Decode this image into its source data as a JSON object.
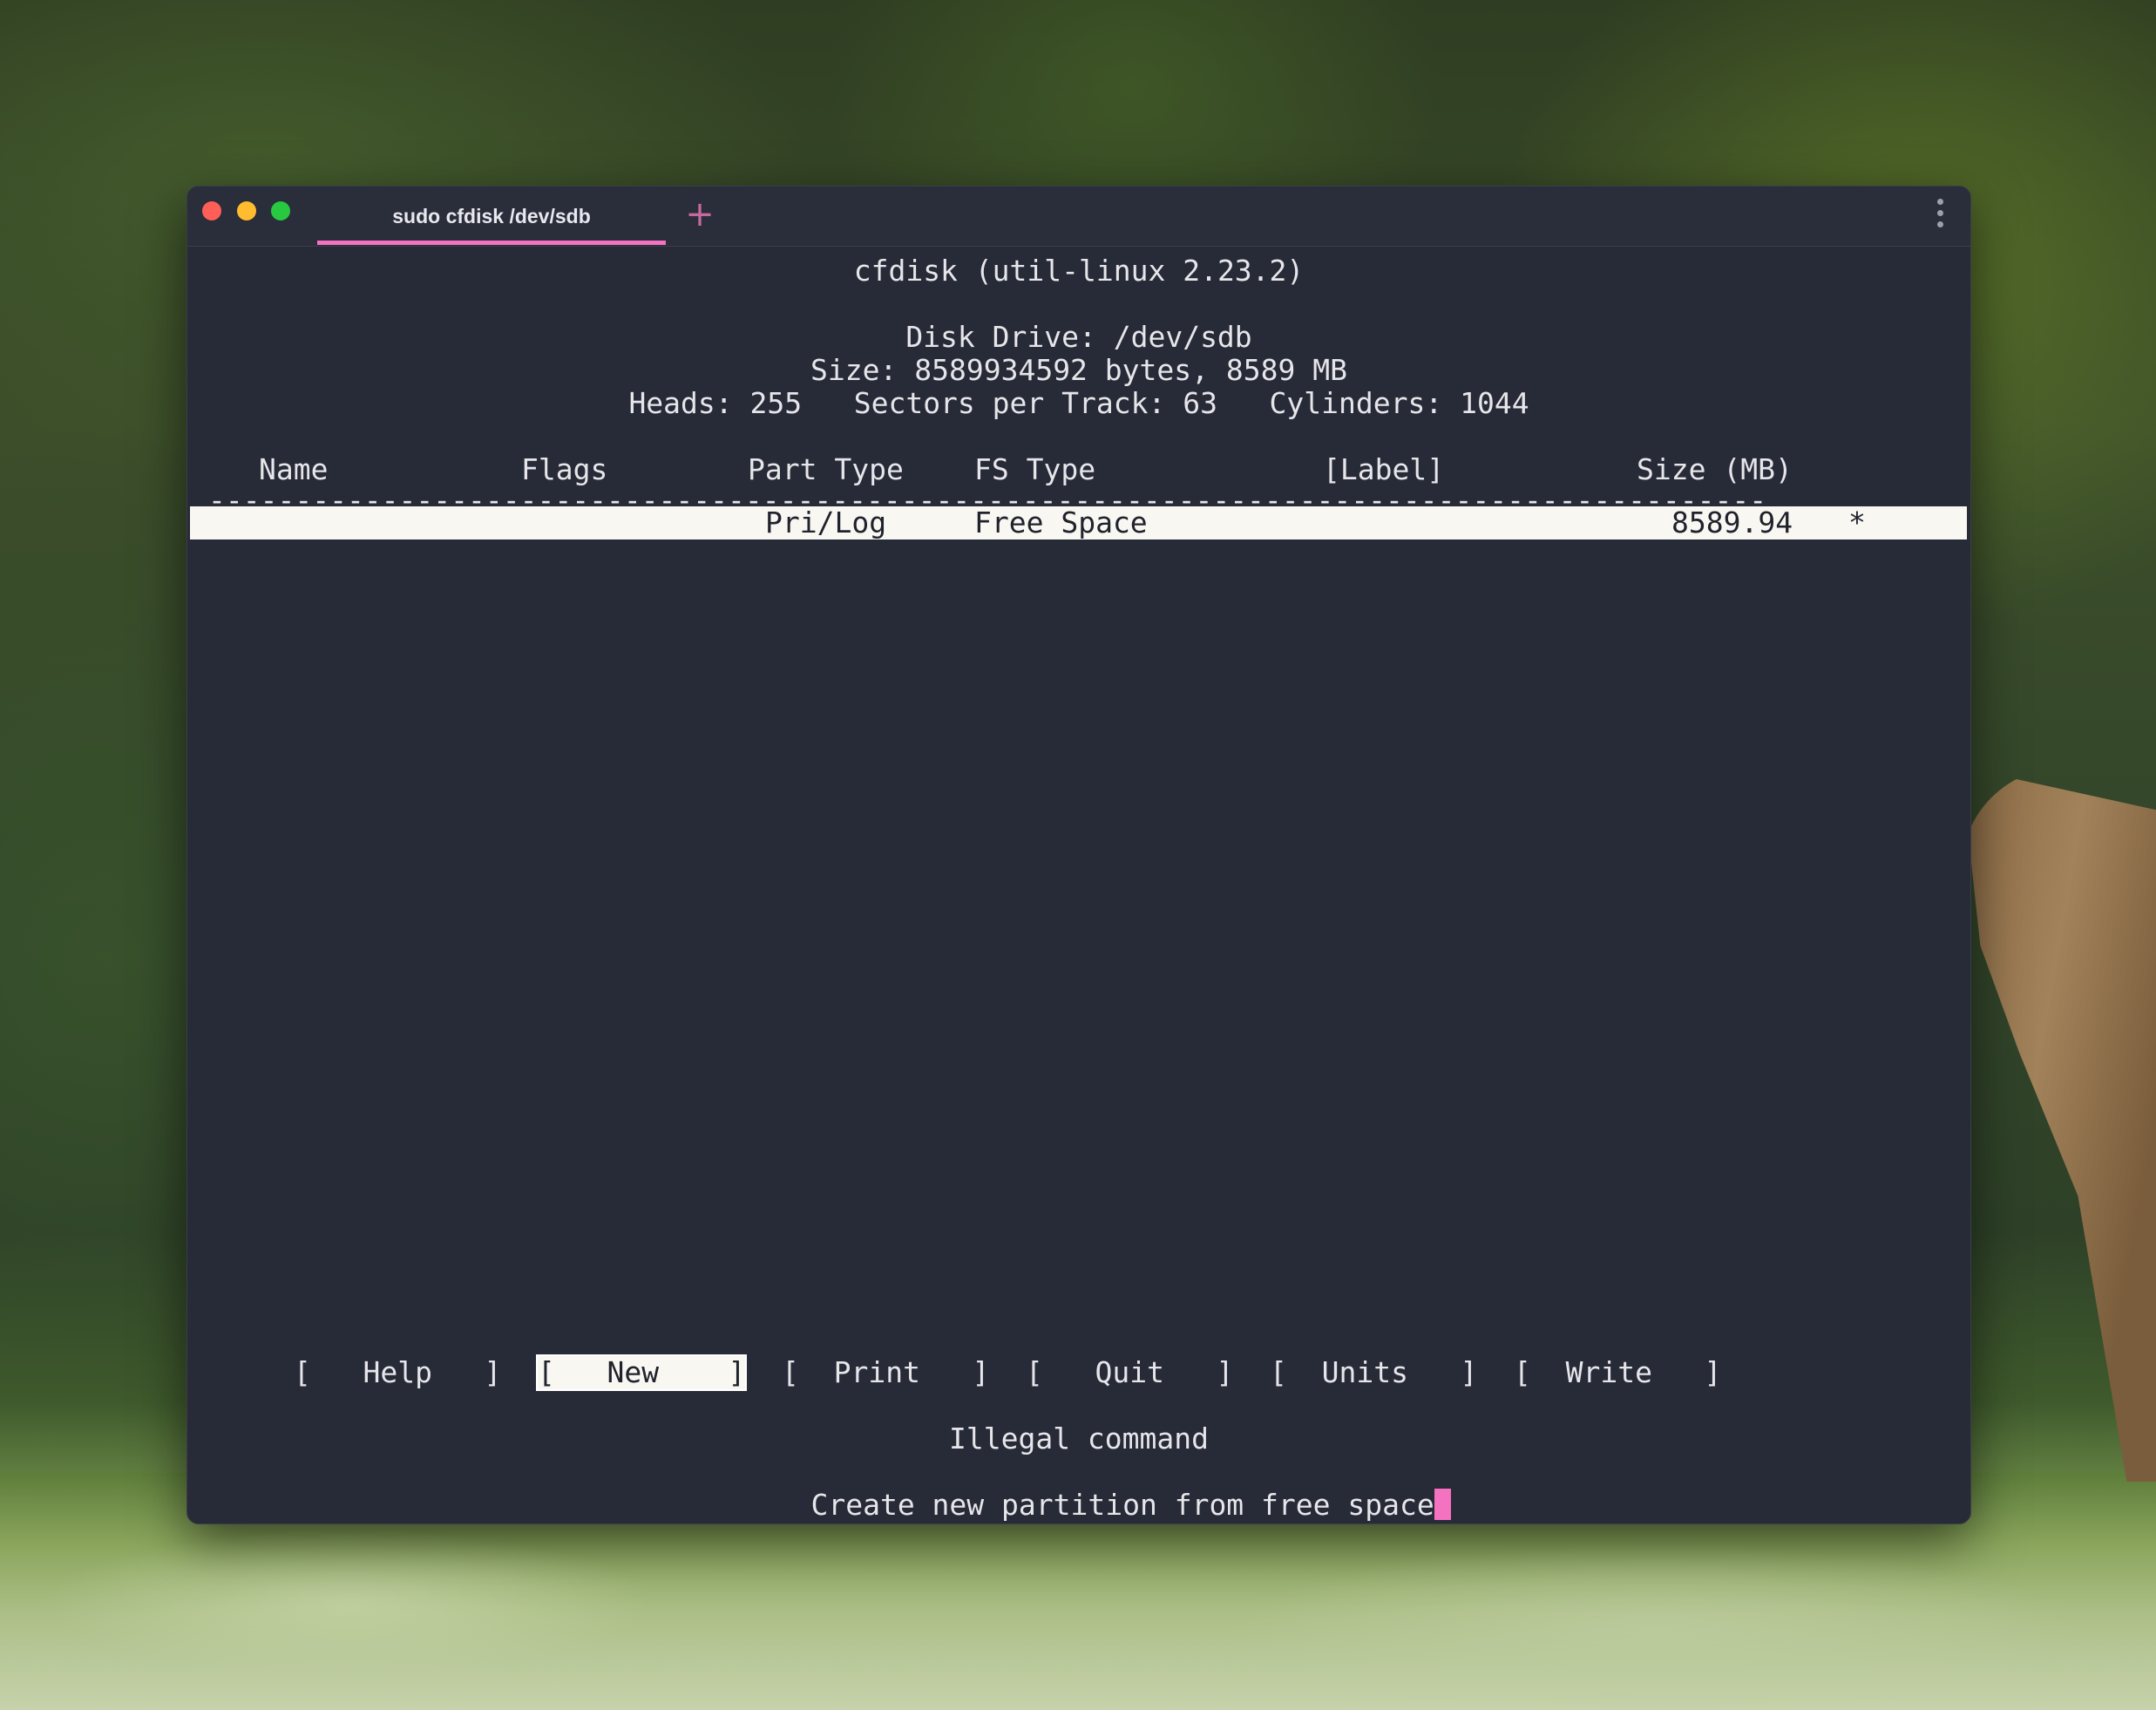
{
  "window": {
    "tab_title": "sudo cfdisk /dev/sdb",
    "new_tab_symbol": "+",
    "accent_color": "#f472c0"
  },
  "terminal": {
    "header": "cfdisk (util-linux 2.23.2)",
    "disk_drive": "Disk Drive: /dev/sdb",
    "size_line": "Size: 8589934592 bytes, 8589 MB",
    "geometry_line": "Heads: 255   Sectors per Track: 63   Cylinders: 1044",
    "columns": {
      "name": "Name",
      "flags": "Flags",
      "part_type": "Part Type",
      "fs_type": "FS Type",
      "label": "[Label]",
      "size": "Size (MB)"
    },
    "separator": "------------------------------------------------------------------------------------------",
    "rows": [
      {
        "name": "",
        "flags": "",
        "part_type": "Pri/Log",
        "fs_type": "Free Space",
        "label": "",
        "size": "8589.94",
        "marker": "*"
      }
    ],
    "menu": {
      "help": "[   Help   ]",
      "new": "[   New    ]",
      "print": "[  Print   ]",
      "quit": "[   Quit   ]",
      "units": "[  Units   ]",
      "write": "[  Write   ]"
    },
    "status_message": "Illegal command",
    "hint_message": "Create new partition from free space"
  }
}
